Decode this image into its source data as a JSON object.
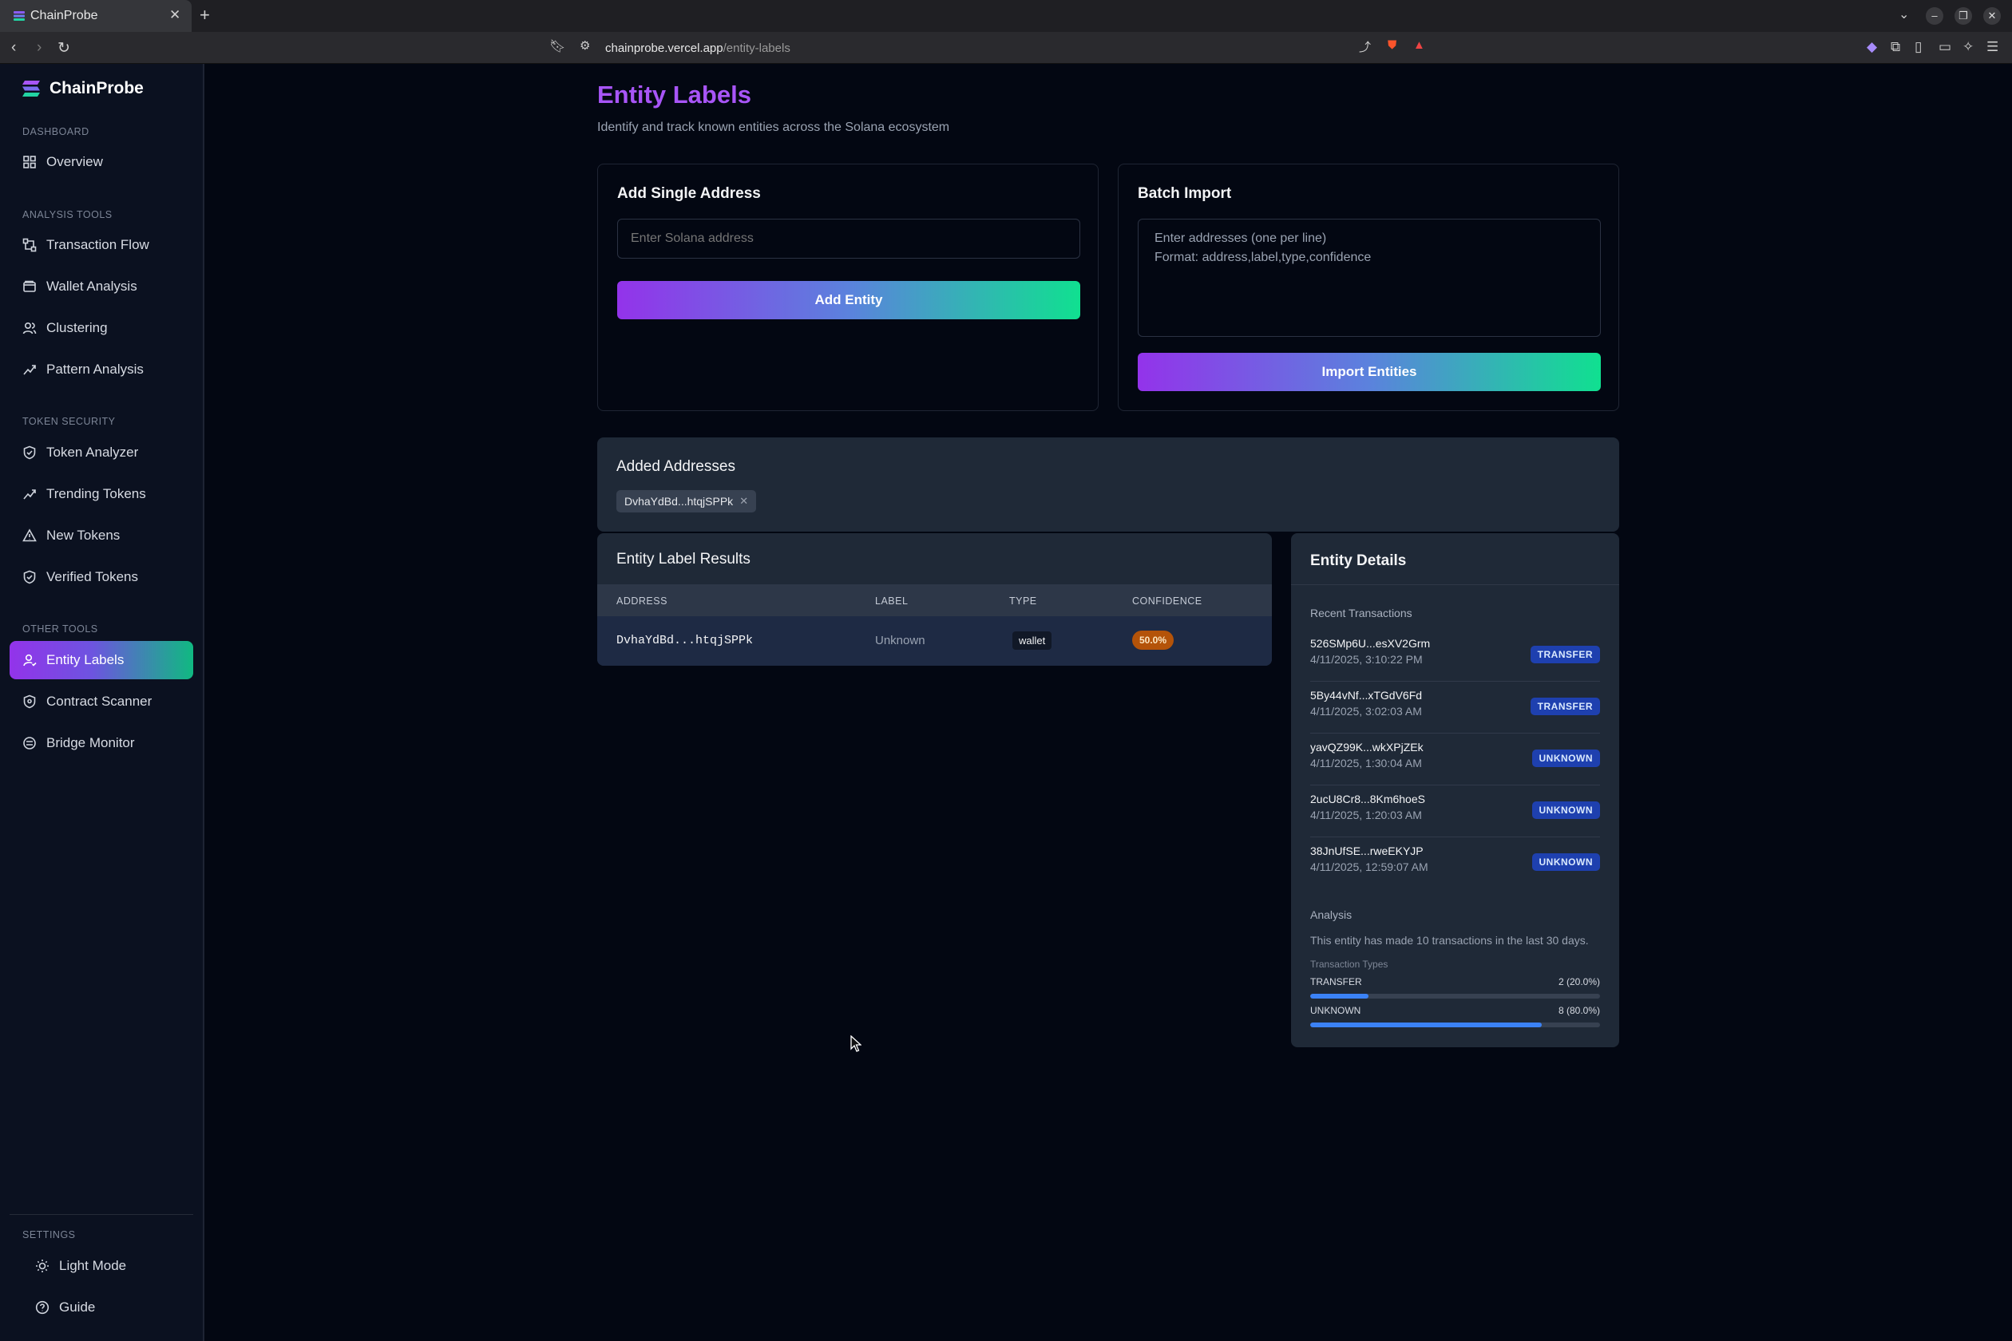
{
  "browser": {
    "tab_title": "ChainProbe",
    "url_host": "chainprobe.vercel.app",
    "url_path": "/entity-labels"
  },
  "sidebar": {
    "brand": "ChainProbe",
    "sections": {
      "dashboard": "DASHBOARD",
      "analysis": "ANALYSIS TOOLS",
      "token_security": "TOKEN SECURITY",
      "other": "OTHER TOOLS",
      "settings": "SETTINGS"
    },
    "items": {
      "overview": "Overview",
      "transaction_flow": "Transaction Flow",
      "wallet_analysis": "Wallet Analysis",
      "clustering": "Clustering",
      "pattern_analysis": "Pattern Analysis",
      "token_analyzer": "Token Analyzer",
      "trending_tokens": "Trending Tokens",
      "new_tokens": "New Tokens",
      "verified_tokens": "Verified Tokens",
      "entity_labels": "Entity Labels",
      "contract_scanner": "Contract Scanner",
      "bridge_monitor": "Bridge Monitor"
    },
    "settings": {
      "light_mode": "Light Mode",
      "guide": "Guide"
    }
  },
  "page": {
    "title": "Entity Labels",
    "subtitle": "Identify and track known entities across the Solana ecosystem"
  },
  "single": {
    "title": "Add Single Address",
    "placeholder": "Enter Solana address",
    "button": "Add Entity"
  },
  "batch": {
    "title": "Batch Import",
    "placeholder": "Enter addresses (one per line)\nFormat: address,label,type,confidence",
    "button": "Import Entities"
  },
  "added": {
    "title": "Added Addresses",
    "chips": [
      "DvhaYdBd...htqjSPPk"
    ]
  },
  "results": {
    "title": "Entity Label Results",
    "columns": [
      "ADDRESS",
      "LABEL",
      "TYPE",
      "CONFIDENCE"
    ],
    "rows": [
      {
        "address": "DvhaYdBd...htqjSPPk",
        "label": "Unknown",
        "type": "wallet",
        "confidence": "50.0%"
      }
    ]
  },
  "details": {
    "title": "Entity Details",
    "recent_label": "Recent Transactions",
    "transactions": [
      {
        "hash": "526SMp6U...esXV2Grm",
        "time": "4/11/2025, 3:10:22 PM",
        "type": "TRANSFER"
      },
      {
        "hash": "5By44vNf...xTGdV6Fd",
        "time": "4/11/2025, 3:02:03 AM",
        "type": "TRANSFER"
      },
      {
        "hash": "yavQZ99K...wkXPjZEk",
        "time": "4/11/2025, 1:30:04 AM",
        "type": "UNKNOWN"
      },
      {
        "hash": "2ucU8Cr8...8Km6hoeS",
        "time": "4/11/2025, 1:20:03 AM",
        "type": "UNKNOWN"
      },
      {
        "hash": "38JnUfSE...rweEKYJP",
        "time": "4/11/2025, 12:59:07 AM",
        "type": "UNKNOWN"
      }
    ],
    "analysis_label": "Analysis",
    "analysis_text": "This entity has made 10 transactions in the last 30 days.",
    "types_label": "Transaction Types",
    "types": [
      {
        "name": "TRANSFER",
        "value": "2 (20.0%)",
        "fraction": 0.2
      },
      {
        "name": "UNKNOWN",
        "value": "8 (80.0%)",
        "fraction": 0.8
      }
    ]
  },
  "colors": {
    "accent_purple": "#a855f7",
    "gradient_start": "#9333ea",
    "gradient_end": "#10e090",
    "badge_blue": "#1e40af",
    "confidence_amber": "#b45309"
  }
}
